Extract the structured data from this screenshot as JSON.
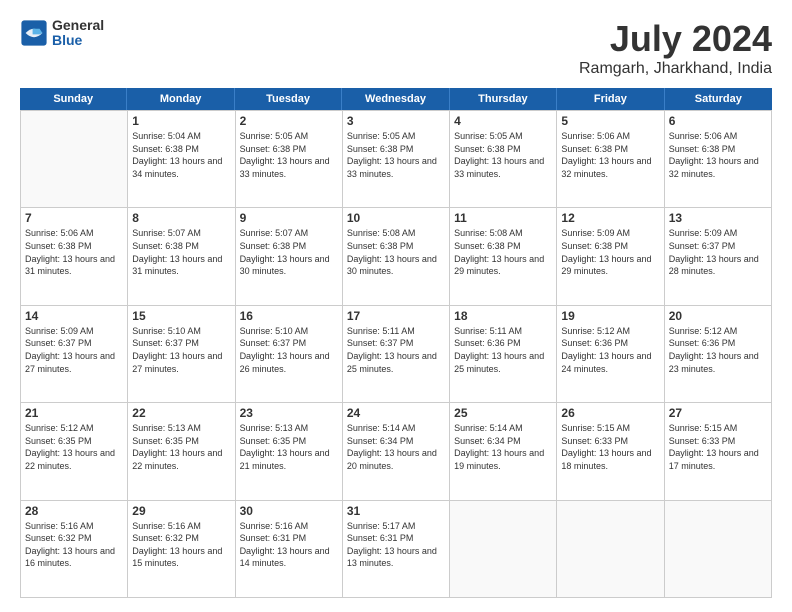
{
  "header": {
    "logo": {
      "general": "General",
      "blue": "Blue"
    },
    "title": "July 2024",
    "location": "Ramgarh, Jharkhand, India"
  },
  "calendar": {
    "weekdays": [
      "Sunday",
      "Monday",
      "Tuesday",
      "Wednesday",
      "Thursday",
      "Friday",
      "Saturday"
    ],
    "weeks": [
      [
        {
          "day": "",
          "empty": true
        },
        {
          "day": "1",
          "sunrise": "Sunrise: 5:04 AM",
          "sunset": "Sunset: 6:38 PM",
          "daylight": "Daylight: 13 hours and 34 minutes."
        },
        {
          "day": "2",
          "sunrise": "Sunrise: 5:05 AM",
          "sunset": "Sunset: 6:38 PM",
          "daylight": "Daylight: 13 hours and 33 minutes."
        },
        {
          "day": "3",
          "sunrise": "Sunrise: 5:05 AM",
          "sunset": "Sunset: 6:38 PM",
          "daylight": "Daylight: 13 hours and 33 minutes."
        },
        {
          "day": "4",
          "sunrise": "Sunrise: 5:05 AM",
          "sunset": "Sunset: 6:38 PM",
          "daylight": "Daylight: 13 hours and 33 minutes."
        },
        {
          "day": "5",
          "sunrise": "Sunrise: 5:06 AM",
          "sunset": "Sunset: 6:38 PM",
          "daylight": "Daylight: 13 hours and 32 minutes."
        },
        {
          "day": "6",
          "sunrise": "Sunrise: 5:06 AM",
          "sunset": "Sunset: 6:38 PM",
          "daylight": "Daylight: 13 hours and 32 minutes."
        }
      ],
      [
        {
          "day": "7",
          "sunrise": "Sunrise: 5:06 AM",
          "sunset": "Sunset: 6:38 PM",
          "daylight": "Daylight: 13 hours and 31 minutes."
        },
        {
          "day": "8",
          "sunrise": "Sunrise: 5:07 AM",
          "sunset": "Sunset: 6:38 PM",
          "daylight": "Daylight: 13 hours and 31 minutes."
        },
        {
          "day": "9",
          "sunrise": "Sunrise: 5:07 AM",
          "sunset": "Sunset: 6:38 PM",
          "daylight": "Daylight: 13 hours and 30 minutes."
        },
        {
          "day": "10",
          "sunrise": "Sunrise: 5:08 AM",
          "sunset": "Sunset: 6:38 PM",
          "daylight": "Daylight: 13 hours and 30 minutes."
        },
        {
          "day": "11",
          "sunrise": "Sunrise: 5:08 AM",
          "sunset": "Sunset: 6:38 PM",
          "daylight": "Daylight: 13 hours and 29 minutes."
        },
        {
          "day": "12",
          "sunrise": "Sunrise: 5:09 AM",
          "sunset": "Sunset: 6:38 PM",
          "daylight": "Daylight: 13 hours and 29 minutes."
        },
        {
          "day": "13",
          "sunrise": "Sunrise: 5:09 AM",
          "sunset": "Sunset: 6:37 PM",
          "daylight": "Daylight: 13 hours and 28 minutes."
        }
      ],
      [
        {
          "day": "14",
          "sunrise": "Sunrise: 5:09 AM",
          "sunset": "Sunset: 6:37 PM",
          "daylight": "Daylight: 13 hours and 27 minutes."
        },
        {
          "day": "15",
          "sunrise": "Sunrise: 5:10 AM",
          "sunset": "Sunset: 6:37 PM",
          "daylight": "Daylight: 13 hours and 27 minutes."
        },
        {
          "day": "16",
          "sunrise": "Sunrise: 5:10 AM",
          "sunset": "Sunset: 6:37 PM",
          "daylight": "Daylight: 13 hours and 26 minutes."
        },
        {
          "day": "17",
          "sunrise": "Sunrise: 5:11 AM",
          "sunset": "Sunset: 6:37 PM",
          "daylight": "Daylight: 13 hours and 25 minutes."
        },
        {
          "day": "18",
          "sunrise": "Sunrise: 5:11 AM",
          "sunset": "Sunset: 6:36 PM",
          "daylight": "Daylight: 13 hours and 25 minutes."
        },
        {
          "day": "19",
          "sunrise": "Sunrise: 5:12 AM",
          "sunset": "Sunset: 6:36 PM",
          "daylight": "Daylight: 13 hours and 24 minutes."
        },
        {
          "day": "20",
          "sunrise": "Sunrise: 5:12 AM",
          "sunset": "Sunset: 6:36 PM",
          "daylight": "Daylight: 13 hours and 23 minutes."
        }
      ],
      [
        {
          "day": "21",
          "sunrise": "Sunrise: 5:12 AM",
          "sunset": "Sunset: 6:35 PM",
          "daylight": "Daylight: 13 hours and 22 minutes."
        },
        {
          "day": "22",
          "sunrise": "Sunrise: 5:13 AM",
          "sunset": "Sunset: 6:35 PM",
          "daylight": "Daylight: 13 hours and 22 minutes."
        },
        {
          "day": "23",
          "sunrise": "Sunrise: 5:13 AM",
          "sunset": "Sunset: 6:35 PM",
          "daylight": "Daylight: 13 hours and 21 minutes."
        },
        {
          "day": "24",
          "sunrise": "Sunrise: 5:14 AM",
          "sunset": "Sunset: 6:34 PM",
          "daylight": "Daylight: 13 hours and 20 minutes."
        },
        {
          "day": "25",
          "sunrise": "Sunrise: 5:14 AM",
          "sunset": "Sunset: 6:34 PM",
          "daylight": "Daylight: 13 hours and 19 minutes."
        },
        {
          "day": "26",
          "sunrise": "Sunrise: 5:15 AM",
          "sunset": "Sunset: 6:33 PM",
          "daylight": "Daylight: 13 hours and 18 minutes."
        },
        {
          "day": "27",
          "sunrise": "Sunrise: 5:15 AM",
          "sunset": "Sunset: 6:33 PM",
          "daylight": "Daylight: 13 hours and 17 minutes."
        }
      ],
      [
        {
          "day": "28",
          "sunrise": "Sunrise: 5:16 AM",
          "sunset": "Sunset: 6:32 PM",
          "daylight": "Daylight: 13 hours and 16 minutes."
        },
        {
          "day": "29",
          "sunrise": "Sunrise: 5:16 AM",
          "sunset": "Sunset: 6:32 PM",
          "daylight": "Daylight: 13 hours and 15 minutes."
        },
        {
          "day": "30",
          "sunrise": "Sunrise: 5:16 AM",
          "sunset": "Sunset: 6:31 PM",
          "daylight": "Daylight: 13 hours and 14 minutes."
        },
        {
          "day": "31",
          "sunrise": "Sunrise: 5:17 AM",
          "sunset": "Sunset: 6:31 PM",
          "daylight": "Daylight: 13 hours and 13 minutes."
        },
        {
          "day": "",
          "empty": true
        },
        {
          "day": "",
          "empty": true
        },
        {
          "day": "",
          "empty": true
        }
      ]
    ]
  }
}
